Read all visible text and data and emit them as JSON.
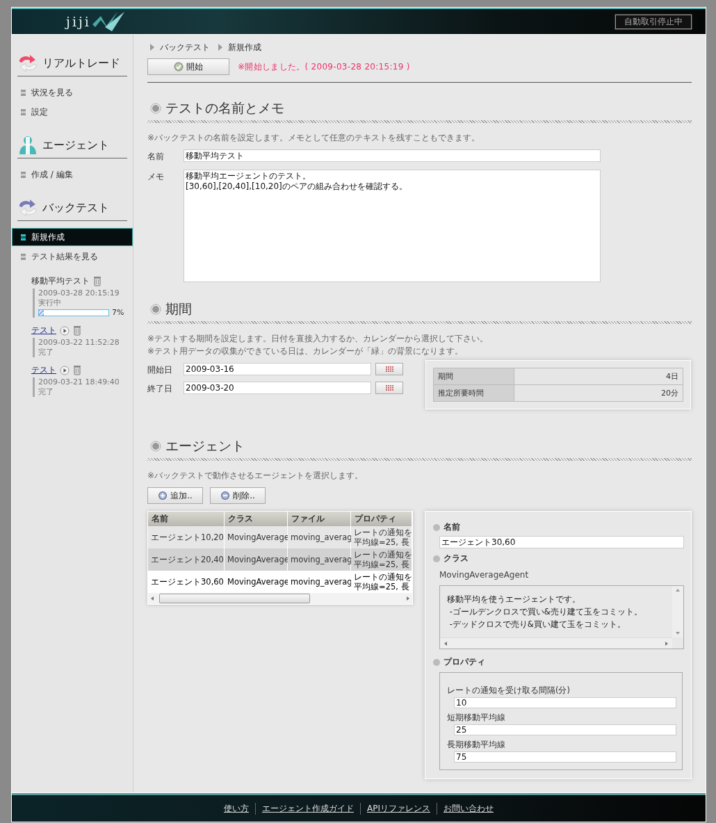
{
  "header": {
    "logo": "jiji",
    "status": "自動取引停止中"
  },
  "sidebar": {
    "sections": [
      {
        "kind": "realtrade",
        "title": "リアルトレード",
        "items": [
          {
            "label": "状況を見る",
            "selected": false
          },
          {
            "label": "設定",
            "selected": false
          }
        ]
      },
      {
        "kind": "agent",
        "title": "エージェント",
        "items": [
          {
            "label": "作成 / 編集",
            "selected": false
          }
        ]
      },
      {
        "kind": "backtest",
        "title": "バックテスト",
        "items": [
          {
            "label": "新規作成",
            "selected": true
          },
          {
            "label": "テスト結果を見る",
            "selected": false
          }
        ],
        "results": [
          {
            "name": "移動平均テスト",
            "link": false,
            "playable": false,
            "time": "2009-03-28 20:15:19",
            "status": "実行中",
            "level": 0.07,
            "percent": "7%"
          },
          {
            "name": "テスト",
            "link": true,
            "playable": true,
            "time": "2009-03-22 11:52:28",
            "status": "完了"
          },
          {
            "name": "テスト",
            "link": true,
            "playable": true,
            "time": "2009-03-21 18:49:40",
            "status": "完了"
          }
        ]
      }
    ]
  },
  "breadcrumb": [
    "バックテスト",
    "新規作成"
  ],
  "start_button": "開始",
  "message": "※開始しました。( 2009-03-28 20:15:19 )",
  "name_memo": {
    "title": "テストの名前とメモ",
    "note": "※バックテストの名前を設定します。メモとして任意のテキストを残すこともできます。",
    "name_label": "名前",
    "name_value": "移動平均テスト",
    "memo_label": "メモ",
    "memo_value": "移動平均エージェントのテスト。\n[30,60],[20,40],[10,20]のペアの組み合わせを確認する。"
  },
  "period": {
    "title": "期間",
    "notes": [
      "※テストする期間を設定します。日付を直接入力するか、カレンダーから選択して下さい。",
      "※テスト用データの収集ができている日は、カレンダーが「緑」の背景になります。"
    ],
    "fields": [
      {
        "label": "開始日",
        "value": "2009-03-16"
      },
      {
        "label": "終了日",
        "value": "2009-03-20"
      }
    ],
    "summary": [
      {
        "label": "期間",
        "value": "4日"
      },
      {
        "label": "推定所要時間",
        "value": "20分"
      }
    ]
  },
  "agents": {
    "title": "エージェント",
    "note": "※バックテストで動作させるエージェントを選択します。",
    "buttons": [
      {
        "kind": "add",
        "label": "追加.."
      },
      {
        "kind": "remove",
        "label": "削除.."
      }
    ],
    "table": {
      "columns": [
        "名前",
        "クラス",
        "ファイル",
        "プロパティ"
      ],
      "rows": [
        {
          "cells": [
            "エージェント10,20",
            "MovingAverage",
            "moving_averag"
          ],
          "property_lines": [
            "レートの通知を",
            "平均線=25, 長"
          ],
          "selected": false
        },
        {
          "cells": [
            "エージェント20,40",
            "MovingAverage",
            "moving_averag"
          ],
          "property_lines": [
            "レートの通知を",
            "平均線=25, 長"
          ],
          "selected": false
        },
        {
          "cells": [
            "エージェント30,60",
            "MovingAverage",
            "moving_averag"
          ],
          "property_lines": [
            "レートの通知を",
            "平均線=25, 長"
          ],
          "selected": true
        }
      ]
    },
    "detail": {
      "name_label": "名前",
      "name_value": "エージェント30,60",
      "class_label": "クラス",
      "class_value": "MovingAverageAgent",
      "description": [
        "移動平均を使うエージェントです。",
        " -ゴールデンクロスで買い&売り建て玉をコミット。",
        " -デッドクロスで売り&買い建て玉をコミット。"
      ],
      "properties_label": "プロパティ",
      "properties": [
        {
          "label": "レートの通知を受け取る間隔(分)",
          "value": "10"
        },
        {
          "label": "短期移動平均線",
          "value": "25"
        },
        {
          "label": "長期移動平均線",
          "value": "75"
        }
      ]
    }
  },
  "footer": [
    "使い方",
    "エージェント作成ガイド",
    "APIリファレンス",
    "お問い合わせ"
  ]
}
